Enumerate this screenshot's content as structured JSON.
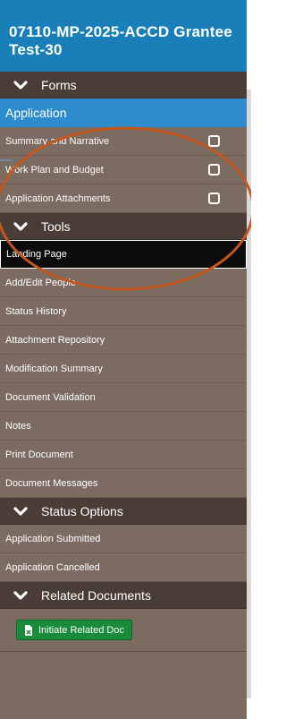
{
  "header": {
    "title": "07110-MP-2025-ACCD Grantee Test-30"
  },
  "sections": {
    "forms": {
      "label": "Forms"
    },
    "tools": {
      "label": "Tools"
    },
    "status": {
      "label": "Status Options"
    },
    "related": {
      "label": "Related Documents"
    }
  },
  "forms": {
    "active_label": "Application",
    "items": [
      {
        "label": "Summary and Narrative"
      },
      {
        "label": "Work Plan and Budget"
      },
      {
        "label": "Application Attachments"
      }
    ]
  },
  "tools": {
    "items": [
      {
        "label": "Landing Page"
      },
      {
        "label": "Add/Edit People"
      },
      {
        "label": "Status History"
      },
      {
        "label": "Attachment Repository"
      },
      {
        "label": "Modification Summary"
      },
      {
        "label": "Document Validation"
      },
      {
        "label": "Notes"
      },
      {
        "label": "Print Document"
      },
      {
        "label": "Document Messages"
      }
    ]
  },
  "status_options": {
    "items": [
      {
        "label": "Application Submitted"
      },
      {
        "label": "Application Cancelled"
      }
    ]
  },
  "related": {
    "initiate_label": "Initiate Related Doc"
  },
  "colors": {
    "header_blue": "#1a7fb8",
    "section_dark": "#4a3c36",
    "panel_brown": "#7b6b61",
    "active_blue": "#2e8ccd",
    "button_green": "#1a8a3b",
    "annotation_orange": "#c4571f"
  },
  "icons": {
    "section_chevron": "chevron-down-icon",
    "checkbox": "checkbox-icon",
    "document": "document-icon"
  }
}
